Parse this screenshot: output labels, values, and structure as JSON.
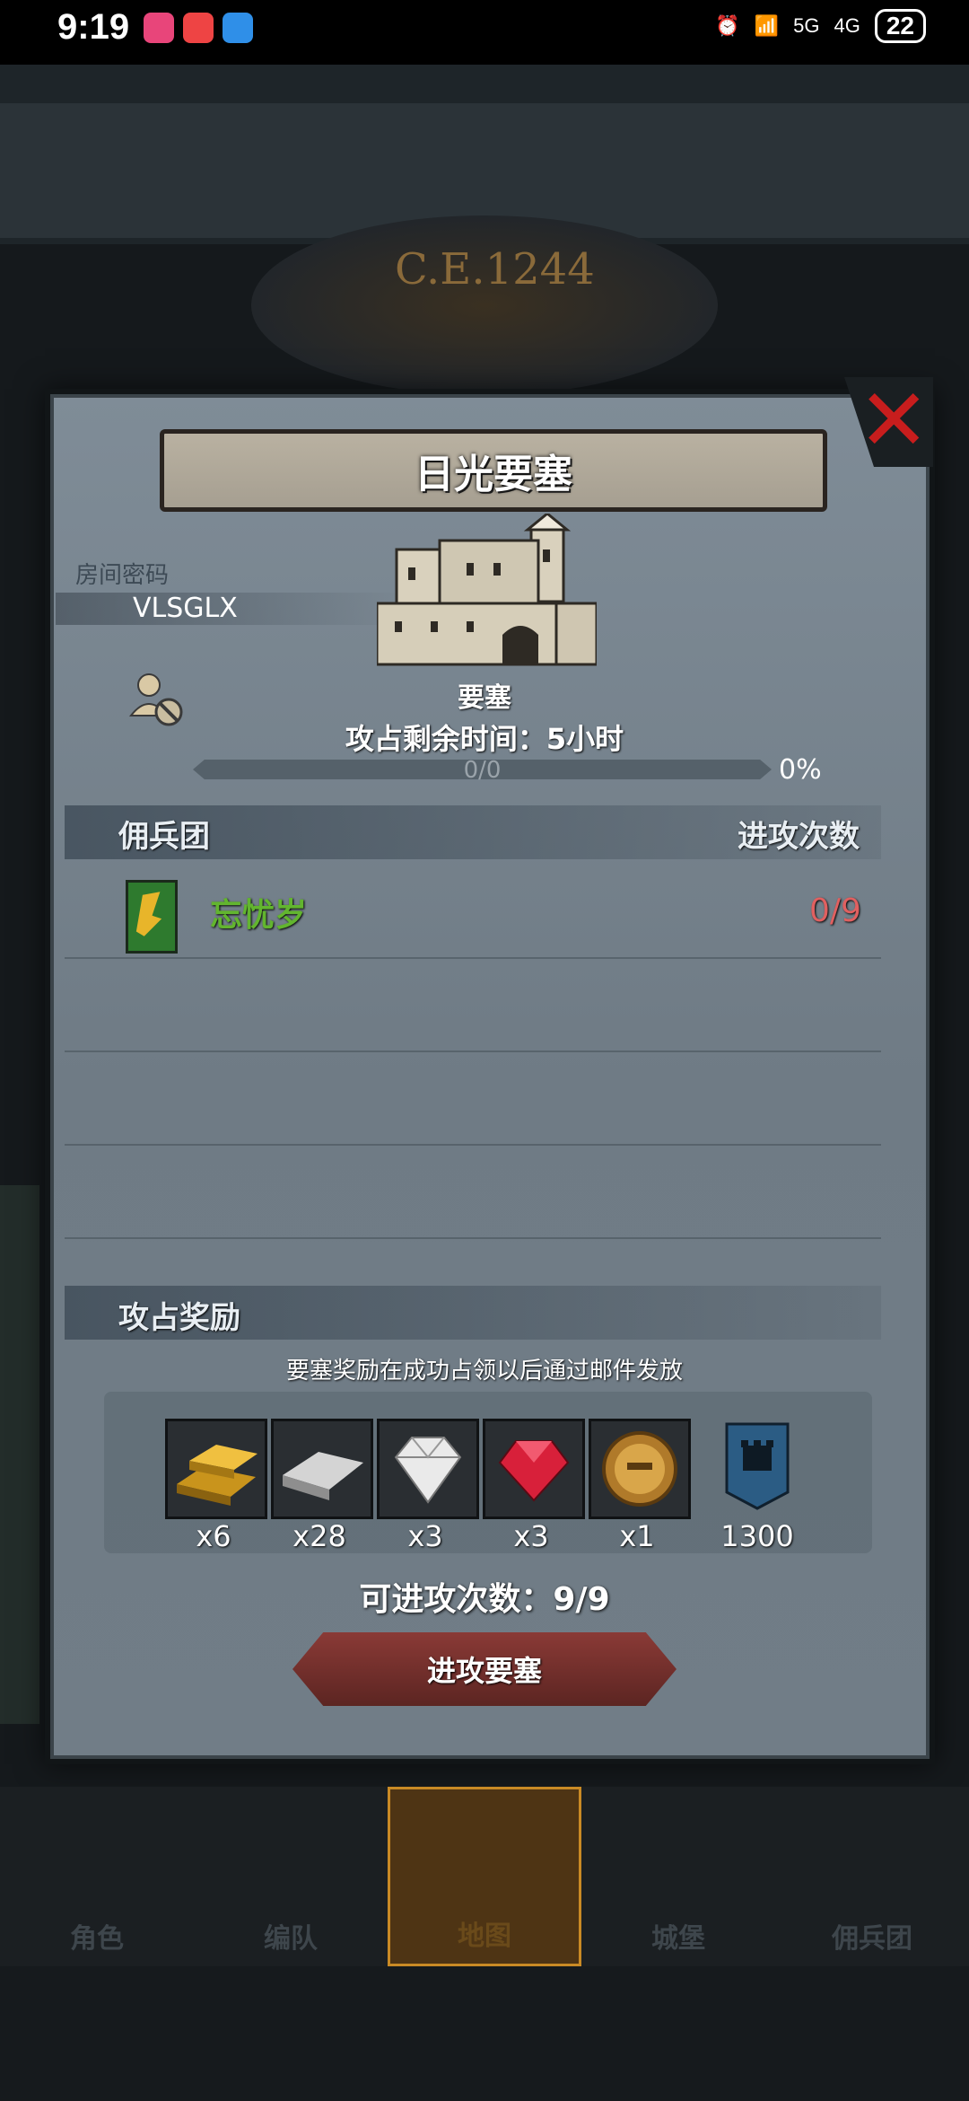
{
  "status_bar": {
    "time": "9:19",
    "signal_1": "5G",
    "signal_2": "4G",
    "battery": "22"
  },
  "background": {
    "era_text": "C.E.1244"
  },
  "dialog": {
    "title": "日光要塞",
    "room_code_label": "房间密码",
    "room_code": "VLSGLX",
    "fortress_label": "要塞",
    "time_remaining": "攻占剩余时间：5小时",
    "progress_text": "0/0",
    "progress_percent": "0%",
    "progress_value": 0,
    "mercenary_header": "佣兵团",
    "attack_count_header": "进攻次数",
    "mercenaries": [
      {
        "name": "忘忧岁",
        "attacks": "0/9"
      }
    ],
    "reward_header": "攻占奖励",
    "reward_note": "要塞奖励在成功占领以后通过邮件发放",
    "rewards": [
      {
        "icon": "gold-bar-icon",
        "count": "x6"
      },
      {
        "icon": "iron-bar-icon",
        "count": "x28"
      },
      {
        "icon": "diamond-icon",
        "count": "x3"
      },
      {
        "icon": "ruby-icon",
        "count": "x3"
      },
      {
        "icon": "helmet-medal-icon",
        "count": "x1"
      },
      {
        "icon": "castle-banner-icon",
        "count": "1300"
      }
    ],
    "attacks_available": "可进攻次数：9/9",
    "attack_button": "进攻要塞"
  },
  "nav": {
    "tabs": [
      {
        "label": "角色",
        "active": false
      },
      {
        "label": "编队",
        "active": false
      },
      {
        "label": "地图",
        "active": true
      },
      {
        "label": "城堡",
        "active": false
      },
      {
        "label": "佣兵团",
        "active": false
      }
    ]
  },
  "colors": {
    "dialog_bg": "#7a8690",
    "close_red": "#c81d1d",
    "guild_green": "#62b52f",
    "count_red": "#e06060",
    "button_red": "#7a302c",
    "nav_active": "#c98a25"
  }
}
